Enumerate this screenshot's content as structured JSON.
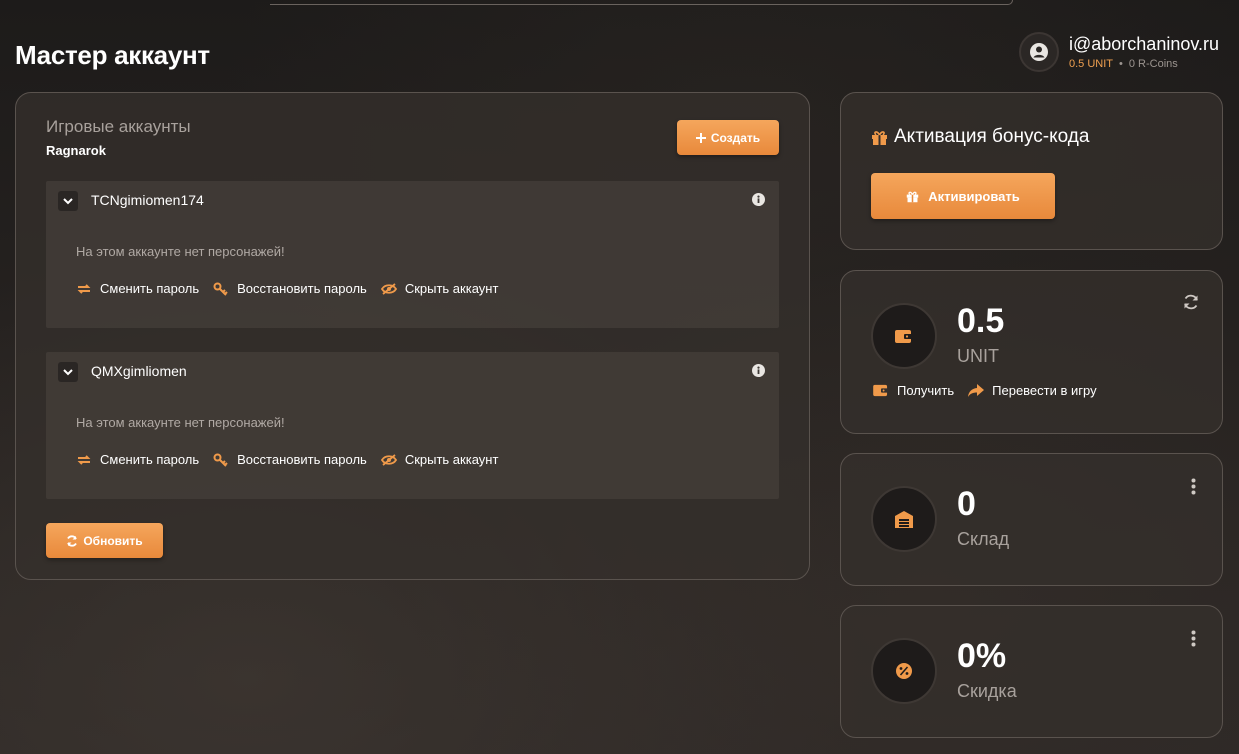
{
  "page": {
    "title": "Мастер аккаунт"
  },
  "user": {
    "email": "i@aborchaninov.ru",
    "unit_balance": "0.5 UNIT",
    "separator": "•",
    "rcoins_balance": "0 R-Coins"
  },
  "accounts": {
    "title": "Игровые аккаунты",
    "game": "Ragnarok",
    "create_label": "Создать",
    "refresh_label": "Обновить",
    "items": [
      {
        "name": "TCNgimiomen174",
        "empty_text": "На этом аккаунте нет персонажей!",
        "change_password": "Сменить пароль",
        "restore_password": "Восстановить пароль",
        "hide_account": "Скрыть аккаунт"
      },
      {
        "name": "QMXgimliomen",
        "empty_text": "На этом аккаунте нет персонажей!",
        "change_password": "Сменить пароль",
        "restore_password": "Восстановить пароль",
        "hide_account": "Скрыть аккаунт"
      }
    ]
  },
  "bonus": {
    "title": "Активация бонус-кода",
    "activate_label": "Активировать"
  },
  "stats": {
    "unit": {
      "value": "0.5",
      "label": "UNIT",
      "get_label": "Получить",
      "transfer_label": "Перевести в игру"
    },
    "stock": {
      "value": "0",
      "label": "Склад"
    },
    "discount": {
      "value": "0%",
      "label": "Скидка"
    }
  },
  "colors": {
    "accent": "#f09a4a",
    "accent_dark": "#e8893b",
    "card_bg": "#342f2c",
    "text_muted": "#a8a19c"
  },
  "icons": [
    "user-icon",
    "plus-icon",
    "chevron-down-icon",
    "info-icon",
    "swap-icon",
    "key-icon",
    "eye-slash-icon",
    "refresh-icon",
    "gift-icon",
    "wallet-icon",
    "share-icon",
    "sync-icon",
    "warehouse-icon",
    "more-vertical-icon",
    "discount-icon"
  ]
}
